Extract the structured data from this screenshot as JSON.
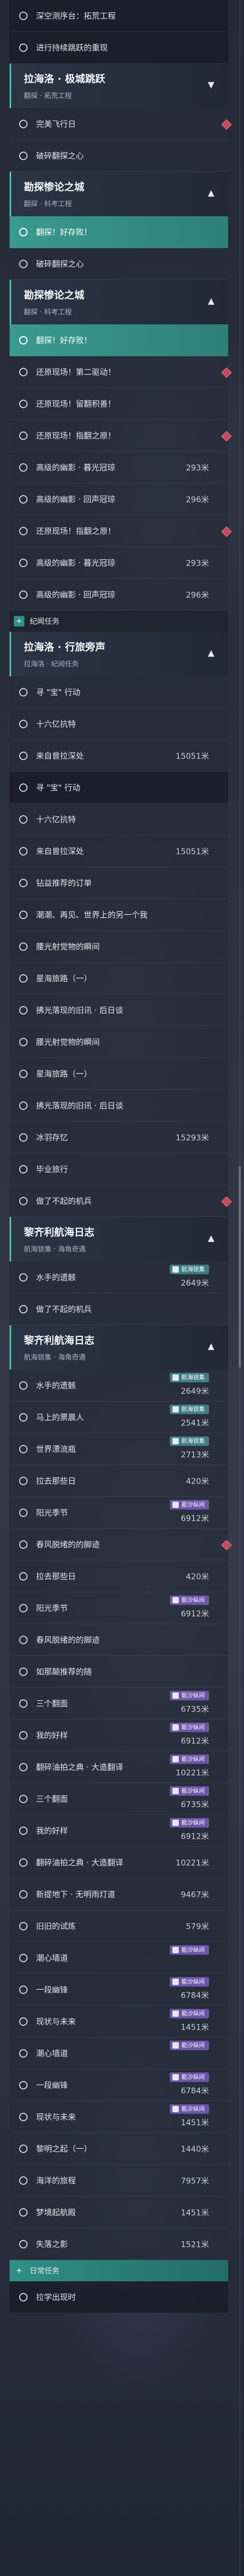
{
  "quest_log": {
    "items": [
      {
        "kind": "row",
        "label": "深空测序台：拓荒工程",
        "style": "dark"
      },
      {
        "kind": "row",
        "label": "进行持续跳跃的重现",
        "style": "dark"
      },
      {
        "kind": "group",
        "title": "拉海洛 · 极城跳跃",
        "subtitle": "翻探 · 拓荒工程",
        "chev": "chevron-down-icon"
      },
      {
        "kind": "row",
        "label": "完美飞行日",
        "diamond": true
      },
      {
        "kind": "row",
        "label": "破碎翻探之心"
      },
      {
        "kind": "group",
        "title": "勘探惨论之城",
        "subtitle": "翻探 · 科考工程",
        "chev": "chevron-up-icon"
      },
      {
        "kind": "row",
        "label": "翻探！好存败！",
        "style": "sel"
      },
      {
        "kind": "row",
        "label": "破碎翻探之心"
      },
      {
        "kind": "group",
        "title": "勘探惨论之城",
        "subtitle": "翻探 · 科考工程",
        "chev": "chevron-up-icon"
      },
      {
        "kind": "row",
        "label": "翻探！好存败！",
        "style": "sel"
      },
      {
        "kind": "row",
        "label": "还原现场！第二驱动！",
        "diamond": true
      },
      {
        "kind": "row",
        "label": "还原现场！留翻积善！"
      },
      {
        "kind": "row",
        "label": "还原现场！指翻之原！",
        "diamond": true
      },
      {
        "kind": "row",
        "label": "高级的幽影 · 暮光冠琼",
        "distance": "293米"
      },
      {
        "kind": "row",
        "label": "高级的幽影 · 回声冠琼",
        "distance": "296米"
      },
      {
        "kind": "row",
        "label": "还原现场！指翻之原！",
        "diamond": true
      },
      {
        "kind": "row",
        "label": "高级的幽影 · 暮光冠琼",
        "distance": "293米"
      },
      {
        "kind": "row",
        "label": "高级的幽影 · 回声冠琼",
        "distance": "296米"
      },
      {
        "kind": "cat",
        "label": "纪闻任务",
        "icon": "plus-icon"
      },
      {
        "kind": "group",
        "title": "拉海洛 · 行旅旁声",
        "subtitle": "拉海洛 · 纪闻任务",
        "chev": "chevron-up-icon"
      },
      {
        "kind": "row",
        "label": "寻 \"宝\" 行动"
      },
      {
        "kind": "row",
        "label": "十六亿抗特"
      },
      {
        "kind": "row",
        "label": "来自曾拉深处",
        "distance": "15051米"
      },
      {
        "kind": "row",
        "label": "寻 \"宝\" 行动",
        "style": "dark"
      },
      {
        "kind": "row",
        "label": "十六亿抗特"
      },
      {
        "kind": "row",
        "label": "来自曾拉深处",
        "distance": "15051米"
      },
      {
        "kind": "row",
        "label": "钻益推荐的订单"
      },
      {
        "kind": "row",
        "label": "潮潮、再见、世界上的另一个我"
      },
      {
        "kind": "row",
        "label": "腰光射觉物的瞬间"
      },
      {
        "kind": "row",
        "label": "星海旅路（一）"
      },
      {
        "kind": "row",
        "label": "拂光落现的旧讯 · 后日谈"
      },
      {
        "kind": "row",
        "label": "腰光射觉物的瞬间"
      },
      {
        "kind": "row",
        "label": "星海旅路（一）"
      },
      {
        "kind": "row",
        "label": "拂光落现的旧讯 · 后日谈"
      },
      {
        "kind": "row",
        "label": "冰羽存忆",
        "distance": "15293米"
      },
      {
        "kind": "row",
        "label": "毕业旅行"
      },
      {
        "kind": "row",
        "label": "做了不起的机兵",
        "diamond": true
      },
      {
        "kind": "group",
        "title": "黎齐利航海日志",
        "subtitle": "航海锁集 · 海角奇遇",
        "chev": "chevron-up-icon"
      },
      {
        "kind": "row",
        "label": "水手的遗骸",
        "distance": "2649米",
        "badge": "航海锁集",
        "badge_color": "teal"
      },
      {
        "kind": "row",
        "label": "做了不起的机兵"
      },
      {
        "kind": "group",
        "title": "黎齐利航海日志",
        "subtitle": "航海锁集 · 海角奇遇",
        "chev": "chevron-up-icon"
      },
      {
        "kind": "row",
        "label": "水手的遗骸",
        "distance": "2649米",
        "badge": "航海锁集",
        "badge_color": "teal"
      },
      {
        "kind": "row",
        "label": "马上的票晨人",
        "distance": "2541米",
        "badge": "航海锁集",
        "badge_color": "teal"
      },
      {
        "kind": "row",
        "label": "世界漂流瓶",
        "distance": "2713米",
        "badge": "航海锁集",
        "badge_color": "teal"
      },
      {
        "kind": "row",
        "label": "拉去那些日",
        "distance": "420米"
      },
      {
        "kind": "row",
        "label": "阳光季节",
        "distance": "6912米",
        "badge": "能沙纵间",
        "badge_color": "purple"
      },
      {
        "kind": "row",
        "label": "春风脱绪的的脚迹",
        "diamond": true
      },
      {
        "kind": "row",
        "label": "拉去那些日",
        "distance": "420米"
      },
      {
        "kind": "row",
        "label": "阳光季节",
        "distance": "6912米",
        "badge": "能沙纵间",
        "badge_color": "purple"
      },
      {
        "kind": "row",
        "label": "春风脱绪的的脚迹"
      },
      {
        "kind": "row",
        "label": "如那颠推荐的随"
      },
      {
        "kind": "row",
        "label": "三个翻面",
        "distance": "6735米",
        "badge": "能沙纵间",
        "badge_color": "purple"
      },
      {
        "kind": "row",
        "label": "我的好样",
        "distance": "6912米",
        "badge": "能沙纵间",
        "badge_color": "purple"
      },
      {
        "kind": "row",
        "label": "翻碎油拍之典 · 大造翻译",
        "distance": "10221米",
        "badge": "能沙纵间",
        "badge_color": "purple"
      },
      {
        "kind": "row",
        "label": "三个翻面",
        "distance": "6735米",
        "badge": "能沙纵间",
        "badge_color": "purple"
      },
      {
        "kind": "row",
        "label": "我的好样",
        "distance": "6912米",
        "badge": "能沙纵间",
        "badge_color": "purple"
      },
      {
        "kind": "row",
        "label": "翻碎油拍之典 · 大造翻译",
        "distance": "10221米"
      },
      {
        "kind": "row",
        "label": "新提地下 · 无明雨灯道",
        "distance": "9467米"
      },
      {
        "kind": "row",
        "label": "旧旧的试炼",
        "distance": "579米"
      },
      {
        "kind": "row",
        "label": "潮心墙道",
        "distance": "",
        "badge": "能沙纵间",
        "badge_color": "purple"
      },
      {
        "kind": "row",
        "label": "一段幽锋",
        "distance": "6784米",
        "badge": "能沙纵间",
        "badge_color": "purple"
      },
      {
        "kind": "row",
        "label": "现状与未来",
        "distance": "1451米",
        "badge": "能沙纵间",
        "badge_color": "purple"
      },
      {
        "kind": "row",
        "label": "潮心墙道",
        "distance": "",
        "badge": "能沙纵间",
        "badge_color": "purple"
      },
      {
        "kind": "row",
        "label": "一段幽锋",
        "distance": "6784米",
        "badge": "能沙纵间",
        "badge_color": "purple"
      },
      {
        "kind": "row",
        "label": "现状与未来",
        "distance": "1451米",
        "badge": "能沙纵间",
        "badge_color": "purple"
      },
      {
        "kind": "row",
        "label": "黎明之起（一）",
        "distance": "1440米"
      },
      {
        "kind": "row",
        "label": "海洋的旅程",
        "distance": "7957米"
      },
      {
        "kind": "row",
        "label": "梦境起航殿",
        "distance": "1451米"
      },
      {
        "kind": "row",
        "label": "失落之影",
        "distance": "1521米"
      },
      {
        "kind": "cat",
        "label": "日常任务",
        "icon": "plus-icon",
        "style": "green"
      },
      {
        "kind": "row",
        "label": "拉学出现时",
        "style": "dark"
      }
    ]
  },
  "colors": {
    "accent": "#3a9a8e",
    "badge_purple": "#6b55a8",
    "badge_teal": "#3f7d86",
    "diamond": "#c24a5a"
  }
}
